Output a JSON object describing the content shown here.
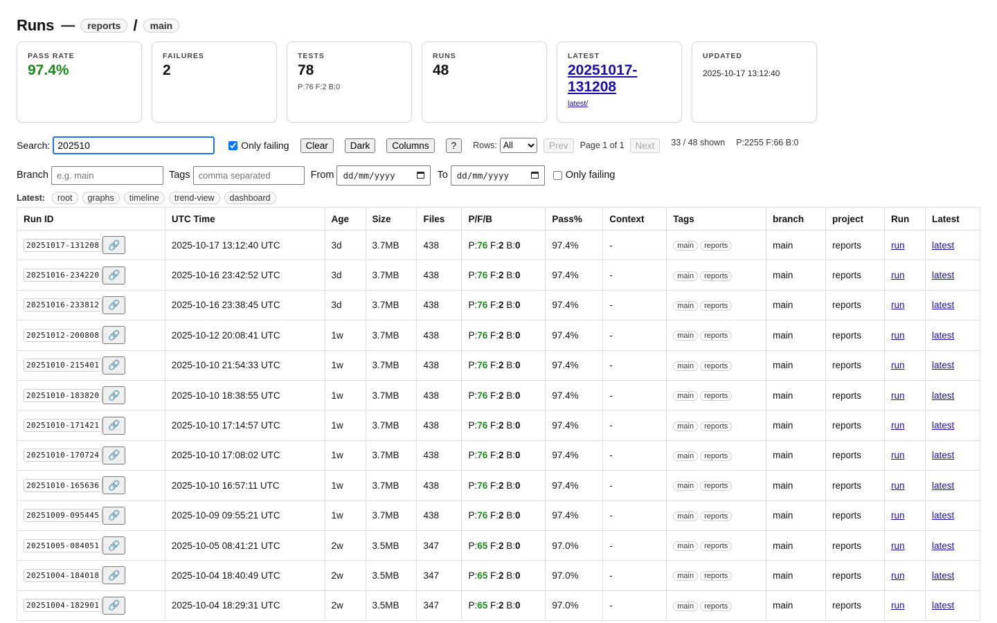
{
  "header": {
    "title": "Runs",
    "dash": "—",
    "project_pill": "reports",
    "slash": "/",
    "branch_pill": "main"
  },
  "cards": {
    "pass_rate": {
      "label": "PASS RATE",
      "value": "97.4%"
    },
    "failures": {
      "label": "FAILURES",
      "value": "2"
    },
    "tests": {
      "label": "TESTS",
      "value": "78",
      "sub": "P:76 F:2 B:0"
    },
    "runs": {
      "label": "RUNS",
      "value": "48"
    },
    "latest": {
      "label": "LATEST",
      "value": "20251017-131208",
      "sub": "latest/"
    },
    "updated": {
      "label": "UPDATED",
      "value": "2025-10-17 13:12:40"
    }
  },
  "toolbar": {
    "search_label": "Search:",
    "search_value": "202510",
    "only_failing_label": "Only failing",
    "clear_label": "Clear",
    "dark_label": "Dark",
    "columns_label": "Columns",
    "help_label": "?",
    "rows_label": "Rows:",
    "rows_value": "All",
    "prev_label": "Prev",
    "page_text": "Page 1 of 1",
    "next_label": "Next",
    "shown_text": "33 / 48 shown",
    "totals_text": "P:2255 F:66 B:0"
  },
  "filters": {
    "branch_label": "Branch",
    "branch_placeholder": "e.g. main",
    "tags_label": "Tags",
    "tags_placeholder": "comma separated",
    "from_label": "From",
    "from_value": "dd/mm/yyyy",
    "to_label": "To",
    "to_value": "dd/mm/yyyy",
    "only_failing_label": "Only failing"
  },
  "latest_links": {
    "label": "Latest:",
    "items": [
      "root",
      "graphs",
      "timeline",
      "trend-view",
      "dashboard"
    ]
  },
  "table": {
    "headers": [
      "Run ID",
      "UTC Time",
      "Age",
      "Size",
      "Files",
      "P/F/B",
      "Pass%",
      "Context",
      "Tags",
      "branch",
      "project",
      "Run",
      "Latest"
    ],
    "rows": [
      {
        "id": "20251017-131208",
        "time": "2025-10-17 13:12:40 UTC",
        "age": "3d",
        "size": "3.7MB",
        "files": "438",
        "p": "76",
        "f": "2",
        "b": "0",
        "pass": "97.4%",
        "context": "-",
        "tags": [
          "main",
          "reports"
        ],
        "branch": "main",
        "project": "reports",
        "run": "run",
        "latest": "latest"
      },
      {
        "id": "20251016-234220",
        "time": "2025-10-16 23:42:52 UTC",
        "age": "3d",
        "size": "3.7MB",
        "files": "438",
        "p": "76",
        "f": "2",
        "b": "0",
        "pass": "97.4%",
        "context": "-",
        "tags": [
          "main",
          "reports"
        ],
        "branch": "main",
        "project": "reports",
        "run": "run",
        "latest": "latest"
      },
      {
        "id": "20251016-233812",
        "time": "2025-10-16 23:38:45 UTC",
        "age": "3d",
        "size": "3.7MB",
        "files": "438",
        "p": "76",
        "f": "2",
        "b": "0",
        "pass": "97.4%",
        "context": "-",
        "tags": [
          "main",
          "reports"
        ],
        "branch": "main",
        "project": "reports",
        "run": "run",
        "latest": "latest"
      },
      {
        "id": "20251012-200808",
        "time": "2025-10-12 20:08:41 UTC",
        "age": "1w",
        "size": "3.7MB",
        "files": "438",
        "p": "76",
        "f": "2",
        "b": "0",
        "pass": "97.4%",
        "context": "-",
        "tags": [
          "main",
          "reports"
        ],
        "branch": "main",
        "project": "reports",
        "run": "run",
        "latest": "latest"
      },
      {
        "id": "20251010-215401",
        "time": "2025-10-10 21:54:33 UTC",
        "age": "1w",
        "size": "3.7MB",
        "files": "438",
        "p": "76",
        "f": "2",
        "b": "0",
        "pass": "97.4%",
        "context": "-",
        "tags": [
          "main",
          "reports"
        ],
        "branch": "main",
        "project": "reports",
        "run": "run",
        "latest": "latest"
      },
      {
        "id": "20251010-183820",
        "time": "2025-10-10 18:38:55 UTC",
        "age": "1w",
        "size": "3.7MB",
        "files": "438",
        "p": "76",
        "f": "2",
        "b": "0",
        "pass": "97.4%",
        "context": "-",
        "tags": [
          "main",
          "reports"
        ],
        "branch": "main",
        "project": "reports",
        "run": "run",
        "latest": "latest"
      },
      {
        "id": "20251010-171421",
        "time": "2025-10-10 17:14:57 UTC",
        "age": "1w",
        "size": "3.7MB",
        "files": "438",
        "p": "76",
        "f": "2",
        "b": "0",
        "pass": "97.4%",
        "context": "-",
        "tags": [
          "main",
          "reports"
        ],
        "branch": "main",
        "project": "reports",
        "run": "run",
        "latest": "latest"
      },
      {
        "id": "20251010-170724",
        "time": "2025-10-10 17:08:02 UTC",
        "age": "1w",
        "size": "3.7MB",
        "files": "438",
        "p": "76",
        "f": "2",
        "b": "0",
        "pass": "97.4%",
        "context": "-",
        "tags": [
          "main",
          "reports"
        ],
        "branch": "main",
        "project": "reports",
        "run": "run",
        "latest": "latest"
      },
      {
        "id": "20251010-165636",
        "time": "2025-10-10 16:57:11 UTC",
        "age": "1w",
        "size": "3.7MB",
        "files": "438",
        "p": "76",
        "f": "2",
        "b": "0",
        "pass": "97.4%",
        "context": "-",
        "tags": [
          "main",
          "reports"
        ],
        "branch": "main",
        "project": "reports",
        "run": "run",
        "latest": "latest"
      },
      {
        "id": "20251009-095445",
        "time": "2025-10-09 09:55:21 UTC",
        "age": "1w",
        "size": "3.7MB",
        "files": "438",
        "p": "76",
        "f": "2",
        "b": "0",
        "pass": "97.4%",
        "context": "-",
        "tags": [
          "main",
          "reports"
        ],
        "branch": "main",
        "project": "reports",
        "run": "run",
        "latest": "latest"
      },
      {
        "id": "20251005-084051",
        "time": "2025-10-05 08:41:21 UTC",
        "age": "2w",
        "size": "3.5MB",
        "files": "347",
        "p": "65",
        "f": "2",
        "b": "0",
        "pass": "97.0%",
        "context": "-",
        "tags": [
          "main",
          "reports"
        ],
        "branch": "main",
        "project": "reports",
        "run": "run",
        "latest": "latest"
      },
      {
        "id": "20251004-184018",
        "time": "2025-10-04 18:40:49 UTC",
        "age": "2w",
        "size": "3.5MB",
        "files": "347",
        "p": "65",
        "f": "2",
        "b": "0",
        "pass": "97.0%",
        "context": "-",
        "tags": [
          "main",
          "reports"
        ],
        "branch": "main",
        "project": "reports",
        "run": "run",
        "latest": "latest"
      },
      {
        "id": "20251004-182901",
        "time": "2025-10-04 18:29:31 UTC",
        "age": "2w",
        "size": "3.5MB",
        "files": "347",
        "p": "65",
        "f": "2",
        "b": "0",
        "pass": "97.0%",
        "context": "-",
        "tags": [
          "main",
          "reports"
        ],
        "branch": "main",
        "project": "reports",
        "run": "run",
        "latest": "latest"
      }
    ]
  },
  "icons": {
    "copy_link": "link-icon",
    "calendar": "calendar-icon"
  },
  "colors": {
    "accent": "#1a73e8",
    "pass_green": "#1a8a1a",
    "link": "#1a0dab"
  }
}
